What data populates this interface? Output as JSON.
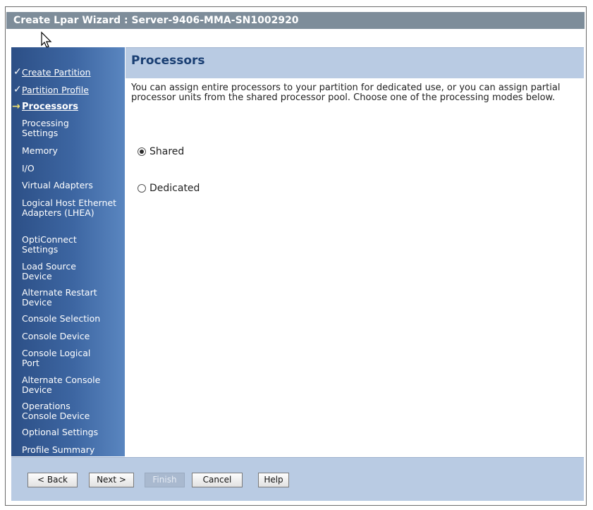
{
  "window": {
    "title": "Create Lpar Wizard : Server-9406-MMA-SN1002920"
  },
  "page": {
    "title": "Processors",
    "description": "You can assign entire processors to your partition for dedicated use, or you can assign partial processor units from the shared processor pool. Choose one of the processing modes below."
  },
  "sidebar": {
    "items": [
      {
        "label": "Create Partition",
        "state": "done"
      },
      {
        "label": "Partition Profile",
        "state": "done"
      },
      {
        "label": "Processors",
        "state": "current"
      },
      {
        "label": "Processing Settings",
        "state": "pending"
      },
      {
        "label": "Memory",
        "state": "pending"
      },
      {
        "label": "I/O",
        "state": "pending"
      },
      {
        "label": "Virtual Adapters",
        "state": "pending"
      },
      {
        "label": "Logical Host Ethernet Adapters (LHEA)",
        "state": "pending"
      },
      {
        "label": "OptiConnect Settings",
        "state": "pending"
      },
      {
        "label": "Load Source Device",
        "state": "pending"
      },
      {
        "label": "Alternate Restart Device",
        "state": "pending"
      },
      {
        "label": "Console Selection",
        "state": "pending"
      },
      {
        "label": "Console Device",
        "state": "pending"
      },
      {
        "label": "Console Logical Port",
        "state": "pending"
      },
      {
        "label": "Alternate Console Device",
        "state": "pending"
      },
      {
        "label": "Operations Console Device",
        "state": "pending"
      },
      {
        "label": "Optional Settings",
        "state": "pending"
      },
      {
        "label": "Profile Summary",
        "state": "pending"
      }
    ]
  },
  "modes": {
    "shared_label": "Shared",
    "dedicated_label": "Dedicated",
    "selected": "Shared"
  },
  "footer": {
    "back_label": "< Back",
    "next_label": "Next >",
    "finish_label": "Finish",
    "cancel_label": "Cancel",
    "help_label": "Help"
  },
  "icons": {
    "check": "checkmark-icon",
    "arrow": "right-arrow-icon",
    "cursor": "mouse-pointer-icon"
  },
  "colors": {
    "titlebar": "#7e8d9a",
    "header_band": "#b9cbe3",
    "sidebar": "#3d66a2",
    "current_arrow": "#f0e070"
  }
}
